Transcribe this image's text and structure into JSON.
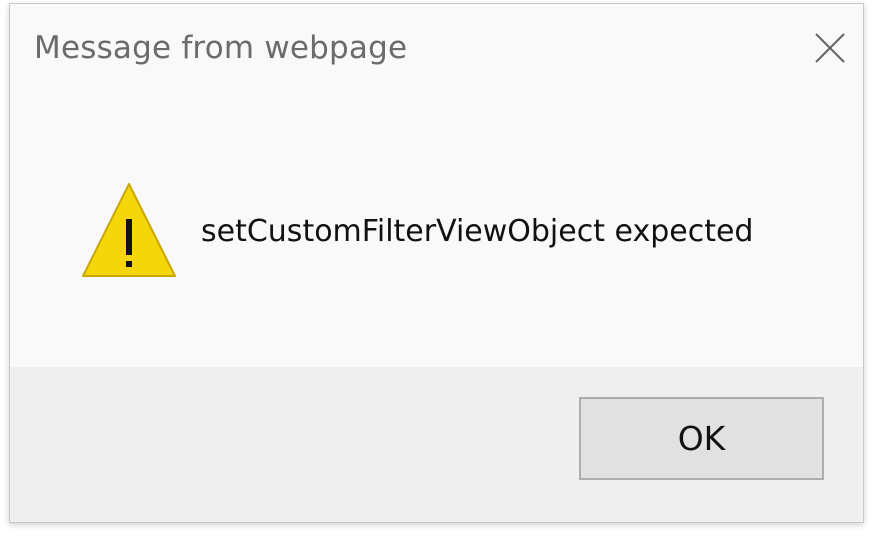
{
  "dialog": {
    "title": "Message from webpage",
    "message": "setCustomFilterViewObject expected",
    "close_icon": "close-icon",
    "warning_icon": "warning-icon",
    "ok_label": "OK"
  },
  "colors": {
    "dialog_bg": "#f9f9f9",
    "footer_bg": "#efefef",
    "warning_fill": "#f5d60a",
    "warning_stroke": "#c9a800",
    "button_bg": "#e1e1e1",
    "button_border": "#adadad"
  }
}
